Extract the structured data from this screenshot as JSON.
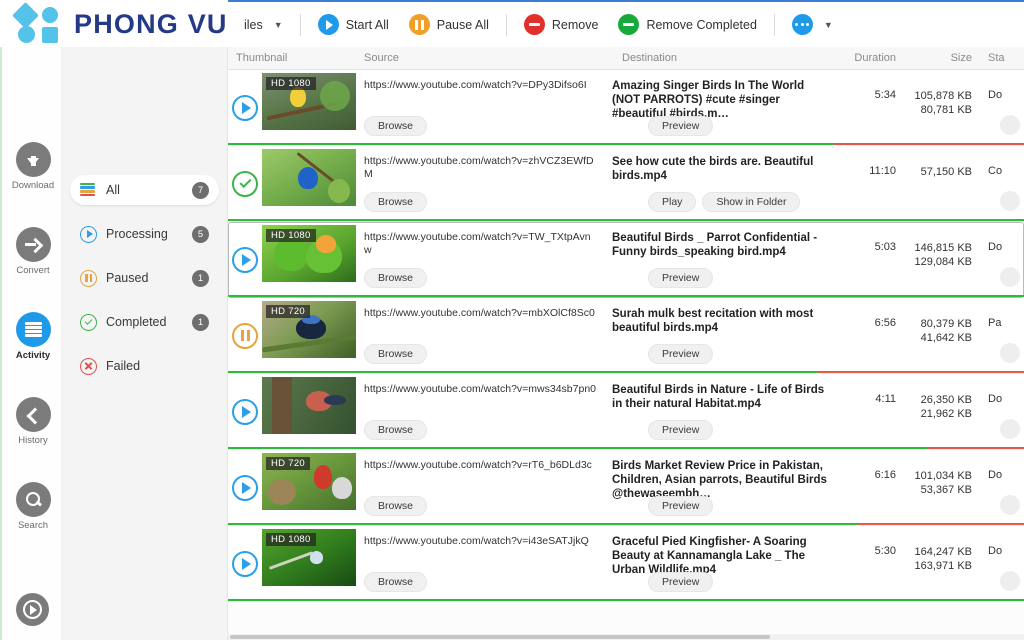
{
  "brand": {
    "name": "PHONG VU"
  },
  "toolbar": {
    "files_label": "iles",
    "start_all": "Start All",
    "pause_all": "Pause All",
    "remove": "Remove",
    "remove_completed": "Remove Completed",
    "more_label": ""
  },
  "rail": {
    "items": [
      {
        "label": "Download",
        "icon": "download-icon",
        "active": false
      },
      {
        "label": "Convert",
        "icon": "convert-arrow-icon",
        "active": false
      },
      {
        "label": "Activity",
        "icon": "activity-list-icon",
        "active": true
      },
      {
        "label": "History",
        "icon": "history-back-icon",
        "active": false
      },
      {
        "label": "Search",
        "icon": "search-icon",
        "active": false
      }
    ],
    "player_label": "media-player"
  },
  "filters": [
    {
      "label": "All",
      "count": "7",
      "icon": "all-lines-icon",
      "selected": true
    },
    {
      "label": "Processing",
      "count": "5",
      "icon": "play-circle-icon",
      "selected": false
    },
    {
      "label": "Paused",
      "count": "1",
      "icon": "pause-circle-icon",
      "selected": false
    },
    {
      "label": "Completed",
      "count": "1",
      "icon": "check-circle-icon",
      "selected": false
    },
    {
      "label": "Failed",
      "count": "",
      "icon": "x-circle-icon",
      "selected": false
    }
  ],
  "table": {
    "columns": {
      "thumbnail": "Thumbnail",
      "source": "Source",
      "destination": "Destination",
      "duration": "Duration",
      "size": "Size",
      "status": "Sta"
    },
    "rows": [
      {
        "state": "downloading",
        "quality": "HD 1080",
        "url": "https://www.youtube.com/watch?v=DPy3Difso6I",
        "title": "Amazing Singer Birds In The  World (NOT PARROTS) #cute #singer #beautiful #birds.m…",
        "duration": "5:34",
        "size_total": "105,878 KB",
        "size_done": "80,781 KB",
        "status": "Do",
        "browse": "Browse",
        "action": "Preview",
        "progress": 76
      },
      {
        "state": "completed",
        "quality": "",
        "url": "https://www.youtube.com/watch?v=zhVCZ3EWfDM",
        "title": "See how cute the birds are. Beautiful birds.mp4",
        "duration": "11:10",
        "size_total": "57,150 KB",
        "size_done": "",
        "status": "Co",
        "browse": "Browse",
        "action": "Play",
        "action2": "Show in Folder",
        "progress": 100
      },
      {
        "state": "downloading",
        "quality": "HD 1080",
        "url": "https://www.youtube.com/watch?v=TW_TXtpAvnw",
        "title": "Beautiful Birds _ Parrot Confidential - Funny birds_speaking bird.mp4",
        "duration": "5:03",
        "size_total": "146,815 KB",
        "size_done": "129,084 KB",
        "status": "Do",
        "browse": "Browse",
        "action": "Preview",
        "progress": 100,
        "selected": true
      },
      {
        "state": "paused",
        "quality": "HD 720",
        "url": "https://www.youtube.com/watch?v=mbXOlCf8Sc0",
        "title": "Surah mulk best recitation with most   beautiful birds.mp4",
        "duration": "6:56",
        "size_total": "80,379 KB",
        "size_done": "41,642 KB",
        "status": "Pa",
        "browse": "Browse",
        "action": "Preview",
        "progress": 74
      },
      {
        "state": "downloading",
        "quality": "",
        "url": "https://www.youtube.com/watch?v=mws34sb7pn0",
        "title": "Beautiful Birds in Nature - Life of Birds in their natural Habitat.mp4",
        "duration": "4:11",
        "size_total": "26,350 KB",
        "size_done": "21,962 KB",
        "status": "Do",
        "browse": "Browse",
        "action": "Preview",
        "progress": 88
      },
      {
        "state": "downloading",
        "quality": "HD 720",
        "url": "https://www.youtube.com/watch?v=rT6_b6DLd3c",
        "title": "Birds Market Review Price in Pakistan, Children, Asian parrots, Beautiful Birds @thewaseembh…",
        "duration": "6:16",
        "size_total": "101,034 KB",
        "size_done": "53,367 KB",
        "status": "Do",
        "browse": "Browse",
        "action": "Preview",
        "progress": 79
      },
      {
        "state": "downloading",
        "quality": "HD 1080",
        "url": "https://www.youtube.com/watch?v=i43eSATJjkQ",
        "title": "Graceful Pied Kingfisher- A Soaring Beauty at Kannamangla Lake _ The Urban Wildlife.mp4",
        "duration": "5:30",
        "size_total": "164,247 KB",
        "size_done": "163,971 KB",
        "status": "Do",
        "browse": "Browse",
        "action": "Preview",
        "progress": 100
      }
    ]
  },
  "colors": {
    "accent_blue": "#1f9ae8",
    "brand_navy": "#253a86",
    "brand_light": "#53c3ea",
    "green": "#3bb44a",
    "orange": "#e8a23e",
    "red": "#e0302c"
  }
}
